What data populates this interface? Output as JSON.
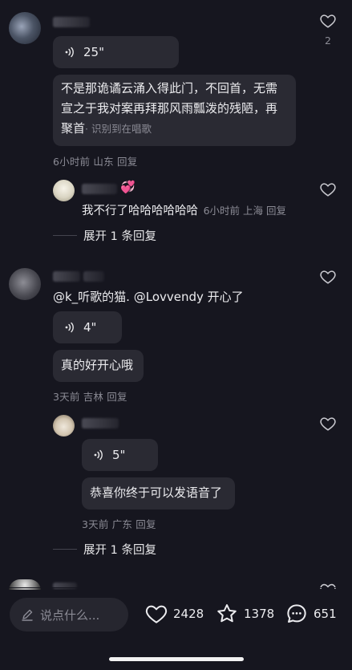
{
  "comment1": {
    "like_count": "2",
    "voice_duration": "25\"",
    "text": "不是那诡谲云涌入得此门，不回首，无需宣之于我对案再拜那风雨瓢泼的残陋，再聚首",
    "source_tag": "· 识别到在唱歌",
    "meta": "6小时前 山东 回复"
  },
  "reply1": {
    "emoji": "💞",
    "text": "我不行了哈哈哈哈哈哈",
    "meta": "6小时前 上海 回复",
    "expand": "展开 1 条回复"
  },
  "comment2": {
    "text": "@k_听歌的猫. @Lovvendy 开心了",
    "voice_duration": "4\"",
    "bubble_text": "真的好开心哦",
    "meta": "3天前 吉林 回复"
  },
  "reply2": {
    "voice_duration": "5\"",
    "bubble_text": "恭喜你终于可以发语音了",
    "meta": "3天前 广东 回复",
    "expand": "展开 1 条回复"
  },
  "bottom_bar": {
    "input_placeholder": "说点什么...",
    "likes": "2428",
    "favorites": "1378",
    "comments": "651"
  },
  "icons": {
    "heart": "heart-outline-icon",
    "star": "star-outline-icon",
    "comment": "comment-bubble-icon",
    "pencil": "pencil-icon",
    "voice": "voice-wave-icon"
  }
}
